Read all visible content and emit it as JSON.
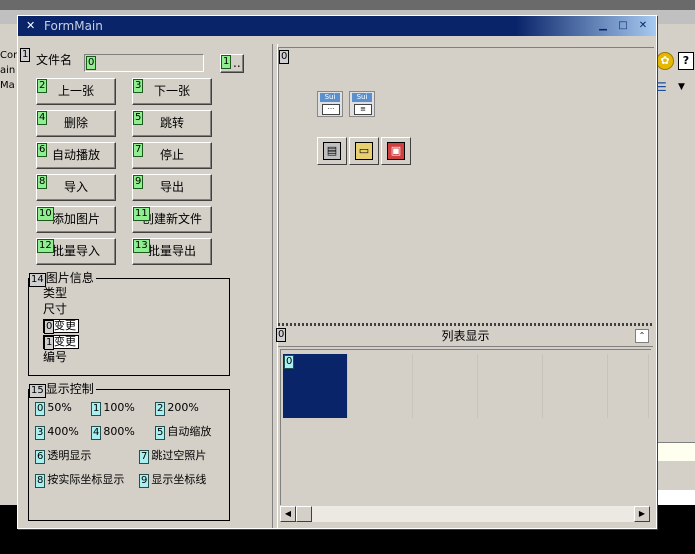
{
  "background": {
    "left_text": [
      "Cons",
      "ain",
      "Ma"
    ],
    "gear_icon": "gear-icon",
    "help_label": "?",
    "dropdown_arrow": "▼"
  },
  "window": {
    "title": "FormMain",
    "min_glyph": "▁",
    "max_glyph": "□",
    "close_glyph": "✕"
  },
  "file": {
    "label": "文件名",
    "field_index": "0",
    "field_value": "",
    "browse_index": "1",
    "browse_label": "..",
    "label_index": "1"
  },
  "buttons": [
    {
      "index": "2",
      "label": "上一张"
    },
    {
      "index": "3",
      "label": "下一张"
    },
    {
      "index": "4",
      "label": "删除"
    },
    {
      "index": "5",
      "label": "跳转"
    },
    {
      "index": "6",
      "label": "自动播放"
    },
    {
      "index": "7",
      "label": "停止"
    },
    {
      "index": "8",
      "label": "导入"
    },
    {
      "index": "9",
      "label": "导出"
    },
    {
      "index": "10",
      "label": "添加图片"
    },
    {
      "index": "11",
      "label": "创建新文件"
    },
    {
      "index": "12",
      "label": "批量导入"
    },
    {
      "index": "13",
      "label": "批量导出"
    }
  ],
  "info": {
    "index": "14",
    "caption": "图片信息",
    "type_label": "类型",
    "size_label": "尺寸",
    "edit0_index": "0",
    "edit0_label": "变更",
    "edit1_index": "1",
    "edit1_label": "变更",
    "number_label": "编号"
  },
  "display": {
    "index": "15",
    "caption": "显示控制",
    "options": [
      {
        "index": "0",
        "label": "50%"
      },
      {
        "index": "1",
        "label": "100%"
      },
      {
        "index": "2",
        "label": "200%"
      },
      {
        "index": "3",
        "label": "400%"
      },
      {
        "index": "4",
        "label": "800%"
      },
      {
        "index": "5",
        "label": "自动缩放"
      },
      {
        "index": "6",
        "label": "透明显示"
      },
      {
        "index": "7",
        "label": "跳过空照片"
      },
      {
        "index": "8",
        "label": "按实际坐标显示"
      },
      {
        "index": "9",
        "label": "显示坐标线"
      }
    ]
  },
  "preview": {
    "index": "0",
    "icon1_label": "Sui",
    "icon2_label": "Sui",
    "save_glyph": "▤",
    "open_glyph": "▭",
    "saveas_glyph": "▣"
  },
  "list": {
    "index": "0",
    "title": "列表显示",
    "collapse_glyph": "⌃",
    "cell_index": "0",
    "left_arrow": "◀",
    "right_arrow": "▶"
  }
}
